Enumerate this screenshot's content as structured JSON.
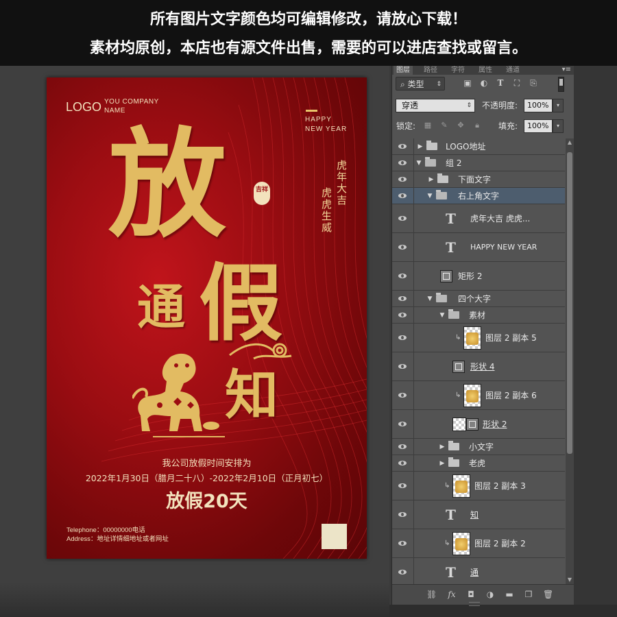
{
  "banner": {
    "line1": "所有图片文字颜色均可编辑修改，请放心下载！",
    "line2": "素材均原创，本店也有源文件出售，需要的可以进店查找或留言。"
  },
  "poster": {
    "logo": "LOGO",
    "company": [
      "YOU COMPANY",
      "NAME"
    ],
    "happy_new_year": [
      "HAPPY",
      "NEW YEAR"
    ],
    "vertical_1": "虎年大吉",
    "vertical_2": "虎虎生威",
    "seal": "吉祥",
    "headline_chars": [
      "放",
      "通",
      "假",
      "知"
    ],
    "info_line1": "我公司放假时间安排为",
    "info_line2": "2022年1月30日（腊月二十八）-2022年2月10日（正月初七）",
    "info_line3": "放假20天",
    "telephone": "Telephone：00000000电话",
    "address": "Address：地址详情细地址或者网址",
    "colors": {
      "bg_center": "#c0141b",
      "bg_edge": "#5a0507",
      "gold": "#e2bb62"
    }
  },
  "panel": {
    "tabs": [
      "图层",
      "路径",
      "字符",
      "属性",
      "通道"
    ],
    "filter_label": "类型",
    "blend_mode": "穿透",
    "opacity_label": "不透明度:",
    "opacity_value": "100%",
    "lock_label": "锁定:",
    "fill_label": "填充:",
    "fill_value": "100%",
    "layers": [
      {
        "name": "LOGO地址",
        "kind": "folder"
      },
      {
        "name": "组 2",
        "kind": "folder-open"
      },
      {
        "name": "下面文字",
        "kind": "folder"
      },
      {
        "name": "右上角文字",
        "kind": "folder-open",
        "selected": true
      },
      {
        "name": "虎年大吉     虎虎...",
        "kind": "text"
      },
      {
        "name": "HAPPY NEW YEAR",
        "kind": "text"
      },
      {
        "name": "矩形 2",
        "kind": "shape"
      },
      {
        "name": "四个大字",
        "kind": "folder-open"
      },
      {
        "name": "素材",
        "kind": "folder-open"
      },
      {
        "name": "图层 2 副本 5",
        "kind": "image"
      },
      {
        "name": "形状 4",
        "kind": "shape"
      },
      {
        "name": "图层 2 副本 6",
        "kind": "image"
      },
      {
        "name": "形状 2",
        "kind": "shape-mask"
      },
      {
        "name": "小文字",
        "kind": "folder"
      },
      {
        "name": "老虎",
        "kind": "folder"
      },
      {
        "name": "图层 2 副本 3",
        "kind": "image"
      },
      {
        "name": "知",
        "kind": "text"
      },
      {
        "name": "图层 2 副本 2",
        "kind": "image"
      },
      {
        "name": "通",
        "kind": "text"
      }
    ]
  }
}
